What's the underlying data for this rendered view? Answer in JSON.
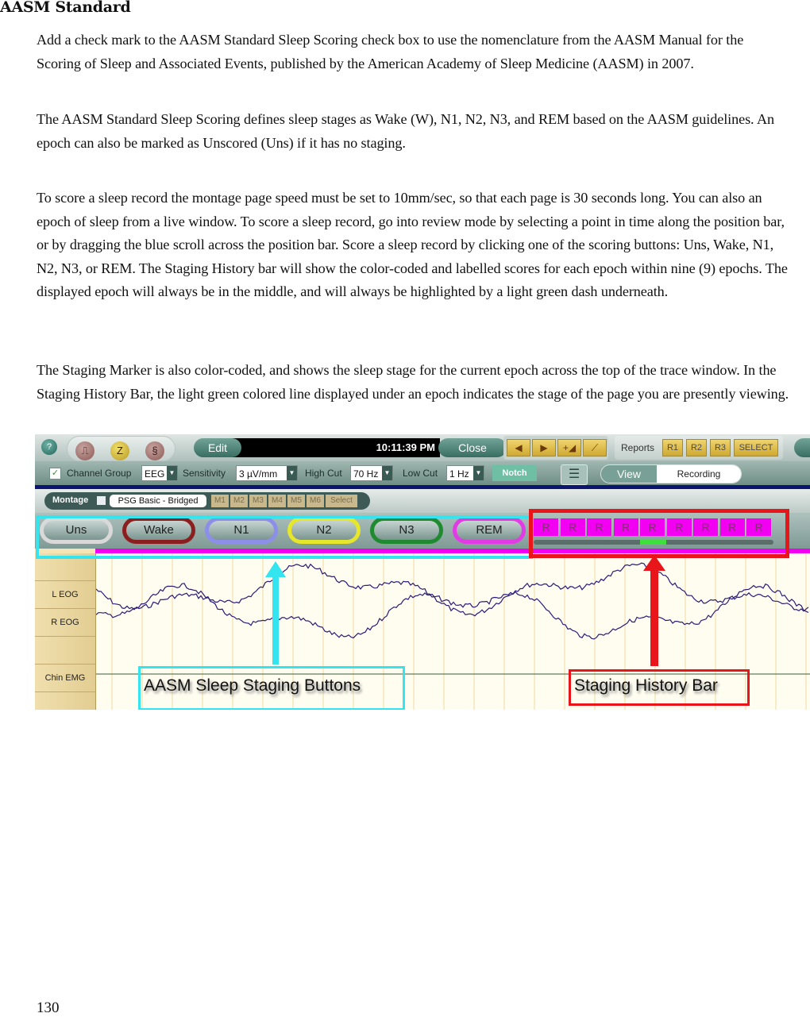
{
  "heading": "AASM Standard",
  "paragraphs": [
    "Add a check mark to the AASM Standard Sleep Scoring check box to use the nomenclature from the AASM Manual for the Scoring of Sleep and Associated Events, published by the American Academy of Sleep Medicine (AASM) in 2007.",
    "The AASM Standard Sleep Scoring defines sleep stages as Wake (W), N1, N2, N3, and REM based on the AASM guidelines. An epoch can also be marked as Unscored (Uns) if it has no staging.",
    "To score a sleep record the montage page speed must be set to 10mm/sec, so that each page is 30 seconds long. You can also an epoch of sleep from a live window. To score a sleep record, go into review mode by selecting a point in time along the position bar, or by dragging the blue scroll across the position bar.  Score a sleep record by clicking one of the scoring buttons: Uns, Wake, N1, N2, N3, or REM. The Staging History bar will show the color-coded and labelled scores for each epoch within nine (9) epochs. The displayed epoch will always be in the middle, and will always be highlighted by a light green dash underneath.",
    "The Staging Marker is also color-coded, and shows the sleep stage for the current epoch across the top of the trace window.  In the Staging History Bar, the light green colored line displayed under an epoch indicates the stage of the page you are presently viewing."
  ],
  "page_number": "130",
  "screenshot": {
    "toolbar": {
      "help_icon": "?",
      "mode_icons": [
        "pulse-icon",
        "sleep-z-icon",
        "script-icon"
      ],
      "mode_glyphs": [
        "⎍",
        "Z",
        "§"
      ],
      "edit_label": "Edit",
      "clock": "10:11:39 PM",
      "close_label": "Close",
      "nav_glyphs": [
        "◀",
        "▶",
        "+◢",
        "⟋"
      ],
      "reports_label": "Reports",
      "report_buttons": [
        "R1",
        "R2",
        "R3",
        "SELECT"
      ]
    },
    "settings": {
      "channel_group_label": "Channel Group",
      "channel_group_value": "EEG",
      "sensitivity_label": "Sensitivity",
      "sensitivity_value": "3 µV/mm",
      "high_cut_label": "High Cut",
      "high_cut_value": "70 Hz",
      "low_cut_label": "Low Cut",
      "low_cut_value": "1 Hz",
      "notch_label": "Notch",
      "view_label": "View",
      "recording_label": "Recording",
      "dropdown_glyph": "▼",
      "checkbox_glyph": "✓",
      "list_glyph": "☰"
    },
    "montage": {
      "label": "Montage",
      "name": "PSG Basic - Bridged",
      "buttons": [
        "M1",
        "M2",
        "M3",
        "M4",
        "M5",
        "M6",
        "Select"
      ]
    },
    "staging_buttons": [
      {
        "label": "Uns",
        "color": "#d9d9d9"
      },
      {
        "label": "Wake",
        "color": "#8b1f1f"
      },
      {
        "label": "N1",
        "color": "#8c8ee8"
      },
      {
        "label": "N2",
        "color": "#e6e62a"
      },
      {
        "label": "N3",
        "color": "#1f8a2f"
      },
      {
        "label": "REM",
        "color": "#e23be6"
      }
    ],
    "staging_history": {
      "epochs": [
        "R",
        "R",
        "R",
        "R",
        "R",
        "R",
        "R",
        "R",
        "R"
      ],
      "color": "#f200f2",
      "current_epoch_index": 4,
      "current_marker_color": "#3ee03e"
    },
    "channels": [
      "",
      "L EOG",
      "R EOG",
      "",
      "Chin EMG",
      ""
    ],
    "callouts": {
      "buttons_label": "AASM Sleep Staging Buttons",
      "buttons_color": "#34e4ee",
      "history_label": "Staging History Bar",
      "history_color": "#e8161a"
    }
  }
}
